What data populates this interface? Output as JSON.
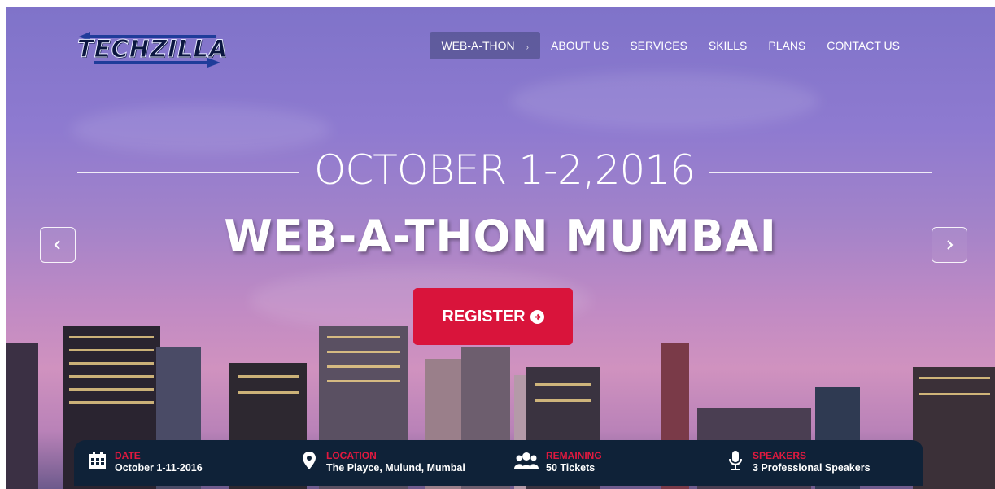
{
  "brand": {
    "logo_text": "TECHZILLA"
  },
  "nav": {
    "items": [
      {
        "label": "WEB-A-THON",
        "active": true,
        "caret": "›"
      },
      {
        "label": "ABOUT US"
      },
      {
        "label": "SERVICES"
      },
      {
        "label": "SKILLS"
      },
      {
        "label": "PLANS"
      },
      {
        "label": "CONTACT US"
      }
    ]
  },
  "hero": {
    "date": "OCTOBER 1-2,2016",
    "title": "WEB-A-THON MUMBAI",
    "register_label": "REGISTER",
    "prev_icon": "chevron-left-icon",
    "next_icon": "chevron-right-icon"
  },
  "info": {
    "date": {
      "label": "DATE",
      "value": "October 1-11-2016",
      "icon": "calendar-icon"
    },
    "location": {
      "label": "LOCATION",
      "value": "The Playce, Mulund, Mumbai",
      "icon": "map-marker-icon"
    },
    "remaining": {
      "label": "REMAINING",
      "value": "50 Tickets",
      "icon": "users-icon"
    },
    "speakers": {
      "label": "SPEAKERS",
      "value": "3 Professional Speakers",
      "icon": "microphone-icon"
    }
  },
  "colors": {
    "accent": "#d9143b",
    "bar": "#0f2238",
    "nav_active": "#444878"
  }
}
